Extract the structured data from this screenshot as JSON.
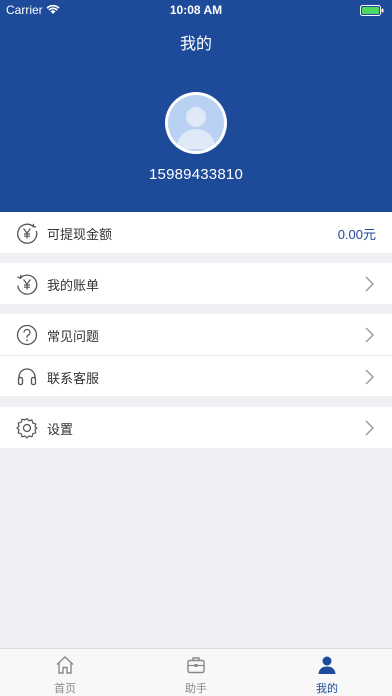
{
  "status_bar": {
    "carrier": "Carrier",
    "time": "10:08 AM"
  },
  "header": {
    "title": "我的",
    "phone": "15989433810"
  },
  "balance": {
    "label": "可提现金额",
    "value": "0.00元"
  },
  "menu": {
    "bill": "我的账单",
    "faq": "常见问题",
    "service": "联系客服",
    "settings": "设置"
  },
  "tabs": [
    {
      "label": "首页",
      "icon": "home-icon"
    },
    {
      "label": "助手",
      "icon": "briefcase-icon"
    },
    {
      "label": "我的",
      "icon": "person-icon"
    }
  ],
  "active_tab": "我的",
  "colors": {
    "brand": "#1e4a9a",
    "background": "#efeff4",
    "text": "#333333"
  }
}
